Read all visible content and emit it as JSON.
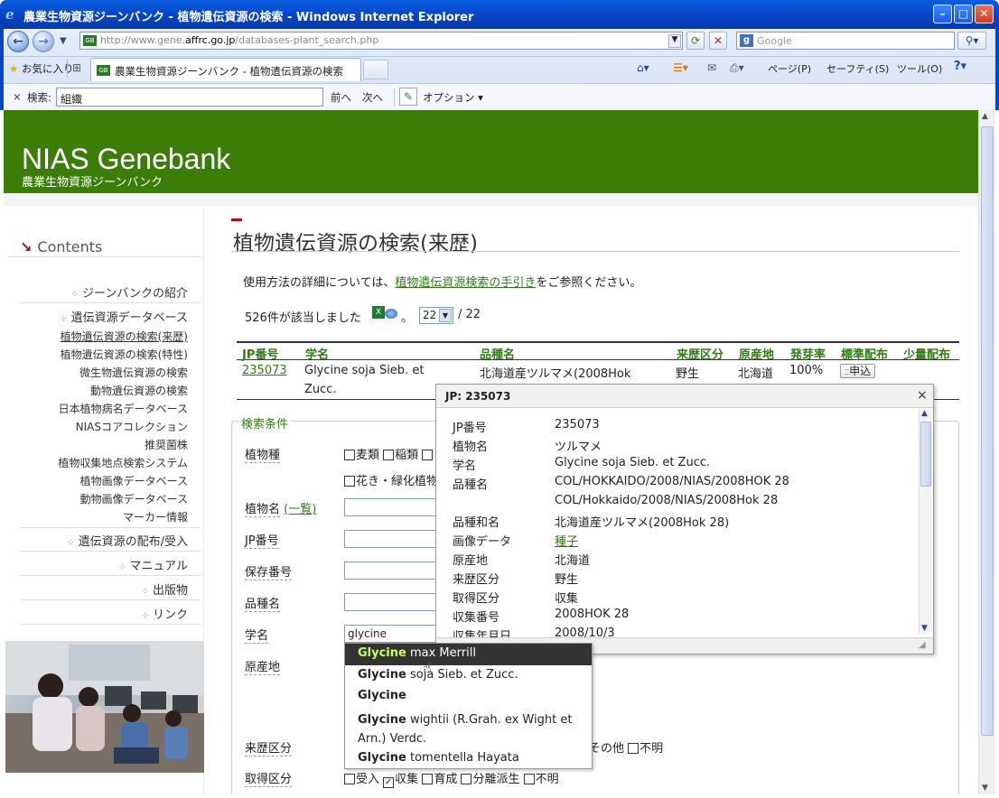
{
  "window": {
    "title": "農業生物資源ジーンバンク - 植物遺伝資源の検索 - Windows Internet Explorer"
  },
  "browser": {
    "address_prefix": "http://www.gene.",
    "address_domain": "affrc.go.jp",
    "address_path": "/databases-plant_search.php",
    "search_placeholder": "Google",
    "favorites_label": "お気に入り",
    "tab_title": "農業生物資源ジーンバンク - 植物遺伝資源の検索",
    "toolbar": {
      "page": "ページ(P)",
      "safety": "セーフティ(S)",
      "tools": "ツール(O)"
    },
    "find": {
      "close": "×",
      "label": "検索:",
      "value": "組織",
      "prev": "前へ",
      "next": "次へ",
      "options": "オプション"
    }
  },
  "site": {
    "title": "NIAS Genebank",
    "subtitle": "農業生物資源ジーンバンク"
  },
  "sidebar": {
    "heading": "Contents",
    "items": [
      "ジーンバンクの紹介",
      "遺伝資源データベース",
      "遺伝資源の配布/受入",
      "マニュアル",
      "出版物",
      "リンク"
    ],
    "sub_items": [
      "植物遺伝資源の検索(来歴)",
      "植物遺伝資源の検索(特性)",
      "微生物遺伝資源の検索",
      "動物遺伝資源の検索",
      "日本植物病名データベース",
      "NIASコアコレクション",
      "推奨菌株",
      "植物収集地点検索システム",
      "植物画像データベース",
      "動物画像データベース",
      "マーカー情報"
    ]
  },
  "main": {
    "title": "植物遺伝資源の検索(来歴)",
    "intro_before": "使用方法の詳細については、",
    "intro_link": "植物遺伝資源検索の手引き",
    "intro_after": "をご参照ください。",
    "count_text": "526件が該当しました",
    "count_sep": "。",
    "page_current": "22",
    "page_total": "/ 22",
    "table": {
      "headers": [
        "JP番号",
        "学名",
        "品種名",
        "来歴区分",
        "原産地",
        "発芽率",
        "標準配布",
        "少量配布"
      ],
      "row": {
        "jp": "235073",
        "sci1": "Glycine soja Sieb. et",
        "sci2": "Zucc.",
        "variety": "北海道産ツルマメ(2008Hok",
        "origin_type": "野生",
        "origin": "北海道",
        "germ": "100%",
        "apply": "申込"
      }
    }
  },
  "form": {
    "legend": "検索条件",
    "labels": {
      "species": "植物種",
      "plant_name": "植物名",
      "plant_name_link": "(一覧)",
      "jp": "JP番号",
      "storage": "保存番号",
      "variety": "品種名",
      "sci": "学名",
      "origin": "原産地",
      "origin_type": "来歴区分",
      "acquire": "取得区分"
    },
    "species_opts": [
      "麦類",
      "稲類"
    ],
    "species_opts2": "花き・緑化植物",
    "sci_value": "glycine",
    "origin_type_opts": [
      "その他",
      "不明"
    ],
    "acquire_opts": [
      "受入",
      "収集",
      "育成",
      "分離派生",
      "不明"
    ]
  },
  "popup": {
    "title": "JP: 235073",
    "close": "×",
    "rows": [
      {
        "k": "JP番号",
        "v": "235073"
      },
      {
        "k": "植物名",
        "v": "ツルマメ"
      },
      {
        "k": "学名",
        "v": "Glycine soja Sieb. et Zucc."
      },
      {
        "k": "品種名",
        "v": "COL/HOKKAIDO/2008/NIAS/2008HOK 28"
      },
      {
        "k": "",
        "v": "COL/Hokkaido/2008/NIAS/2008Hok 28"
      },
      {
        "k": "品種和名",
        "v": "北海道産ツルマメ(2008Hok 28)"
      },
      {
        "k": "画像データ",
        "v": "種子"
      },
      {
        "k": "原産地",
        "v": "北海道"
      },
      {
        "k": "来歴区分",
        "v": "野生"
      },
      {
        "k": "取得区分",
        "v": "収集"
      },
      {
        "k": "収集番号",
        "v": "2008HOK 28"
      },
      {
        "k": "収集年月日",
        "v": "2008/10/3"
      }
    ]
  },
  "autocomplete": [
    {
      "b": "Glycine",
      "r": " max Merrill"
    },
    {
      "b": "Glycine",
      "r": " soja Sieb. et Zucc."
    },
    {
      "b": "Glycine",
      "r": ""
    },
    {
      "b": "Glycine",
      "r": " wightii (R.Grah. ex Wight et Arn.) Verdc."
    },
    {
      "b": "Glycine",
      "r": " tomentella Hayata"
    }
  ]
}
